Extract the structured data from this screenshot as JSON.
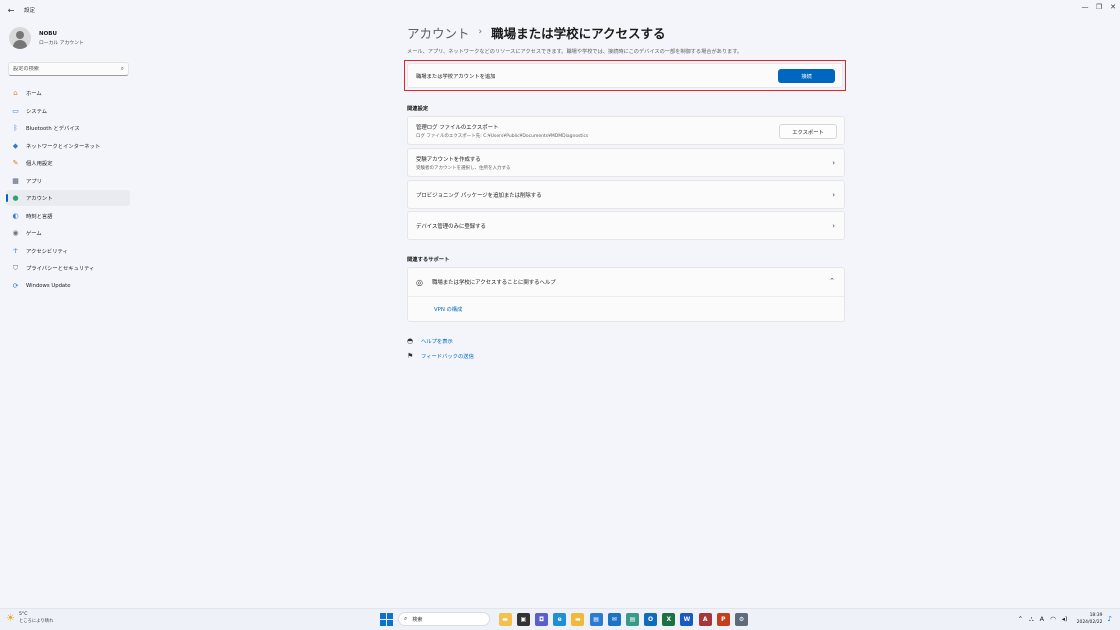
{
  "window": {
    "title": "設定",
    "controls": [
      "—",
      "❐",
      "✕"
    ]
  },
  "profile": {
    "name": "NOBU",
    "account_type": "ローカル アカウント"
  },
  "search": {
    "placeholder": "設定の検索"
  },
  "sidebar": {
    "items": [
      {
        "label": "ホーム",
        "icon": "home-icon",
        "glyph": "⌂",
        "color": "#e08a2c"
      },
      {
        "label": "システム",
        "icon": "monitor-icon",
        "glyph": "▭",
        "color": "#2f7dd1"
      },
      {
        "label": "Bluetooth とデバイス",
        "icon": "bluetooth-icon",
        "glyph": "ᛒ",
        "color": "#2f7dd1"
      },
      {
        "label": "ネットワークとインターネット",
        "icon": "wifi-icon",
        "glyph": "◆",
        "color": "#2f7dd1"
      },
      {
        "label": "個人用設定",
        "icon": "brush-icon",
        "glyph": "✎",
        "color": "#d9822b"
      },
      {
        "label": "アプリ",
        "icon": "apps-icon",
        "glyph": "▦",
        "color": "#4a5a72"
      },
      {
        "label": "アカウント",
        "icon": "person-icon",
        "glyph": "●",
        "color": "#2ea56b",
        "active": true
      },
      {
        "label": "時刻と言語",
        "icon": "globe-clock-icon",
        "glyph": "◐",
        "color": "#2f7dd1"
      },
      {
        "label": "ゲーム",
        "icon": "gamepad-icon",
        "glyph": "◉",
        "color": "#6a7585"
      },
      {
        "label": "アクセシビリティ",
        "icon": "accessibility-icon",
        "glyph": "☥",
        "color": "#2f7dd1"
      },
      {
        "label": "プライバシーとセキュリティ",
        "icon": "shield-icon",
        "glyph": "⛉",
        "color": "#6a7585"
      },
      {
        "label": "Windows Update",
        "icon": "update-icon",
        "glyph": "⟳",
        "color": "#2f7dd1"
      }
    ]
  },
  "main": {
    "breadcrumb_parent": "アカウント",
    "breadcrumb_sep": "›",
    "title": "職場または学校にアクセスする",
    "description": "メール、アプリ、ネットワークなどのリソースにアクセスできます。職場や学校では、接続時にこのデバイスの一部を制御する場合があります。",
    "add_account_label": "職場または学校アカウントを追加",
    "connect_button": "接続",
    "related_settings_header": "関連設定",
    "export_title": "管理ログ ファイルのエクスポート",
    "export_subtitle": "ログ ファイルのエクスポート先: C:¥Users¥Public¥Documents¥MDMDiagnostics",
    "export_button": "エクスポート",
    "test_account_title": "受験アカウントを作成する",
    "test_account_subtitle": "受験者のアカウントを選択し、住所を入力する",
    "provisioning_title": "プロビジョニング パッケージを追加または削除する",
    "device_mgmt_title": "デバイス管理のみに登録する",
    "related_support_header": "関連するサポート",
    "support_title": "職場または学校にアクセスすることに関するヘルプ",
    "vpn_link": "VPN の構成",
    "help_link": "ヘルプを表示",
    "feedback_link": "フィードバックの送信"
  },
  "taskbar": {
    "temperature": "5°C",
    "condition": "ところにより晴れ",
    "search_label": "検索",
    "time": "18:39",
    "date": "2024/02/22",
    "apps": [
      {
        "icon": "file-explorer-icon",
        "glyph": "▬",
        "color": "#f2c14e"
      },
      {
        "icon": "task-view-icon",
        "glyph": "▣",
        "color": "#333333"
      },
      {
        "icon": "chat-icon",
        "glyph": "◘",
        "color": "#5b5fc7"
      },
      {
        "icon": "edge-icon",
        "glyph": "e",
        "color": "#1f8fd8"
      },
      {
        "icon": "folder-icon",
        "glyph": "▬",
        "color": "#f1b93a"
      },
      {
        "icon": "store-icon",
        "glyph": "▤",
        "color": "#2b7bd3"
      },
      {
        "icon": "mail-icon",
        "glyph": "✉",
        "color": "#1a73c7"
      },
      {
        "icon": "notepad-icon",
        "glyph": "▤",
        "color": "#3a9a8a"
      },
      {
        "icon": "outlook-icon",
        "glyph": "O",
        "color": "#0f6cbd"
      },
      {
        "icon": "excel-icon",
        "glyph": "X",
        "color": "#1d7044"
      },
      {
        "icon": "word-icon",
        "glyph": "W",
        "color": "#185abd"
      },
      {
        "icon": "access-icon",
        "glyph": "A",
        "color": "#a4373a"
      },
      {
        "icon": "powerpoint-icon",
        "glyph": "P",
        "color": "#c43e1c"
      },
      {
        "icon": "settings-icon",
        "glyph": "⚙",
        "color": "#5d6b7d"
      }
    ]
  },
  "colors": {
    "accent": "#0067c0",
    "highlight_border": "#e0262b"
  }
}
